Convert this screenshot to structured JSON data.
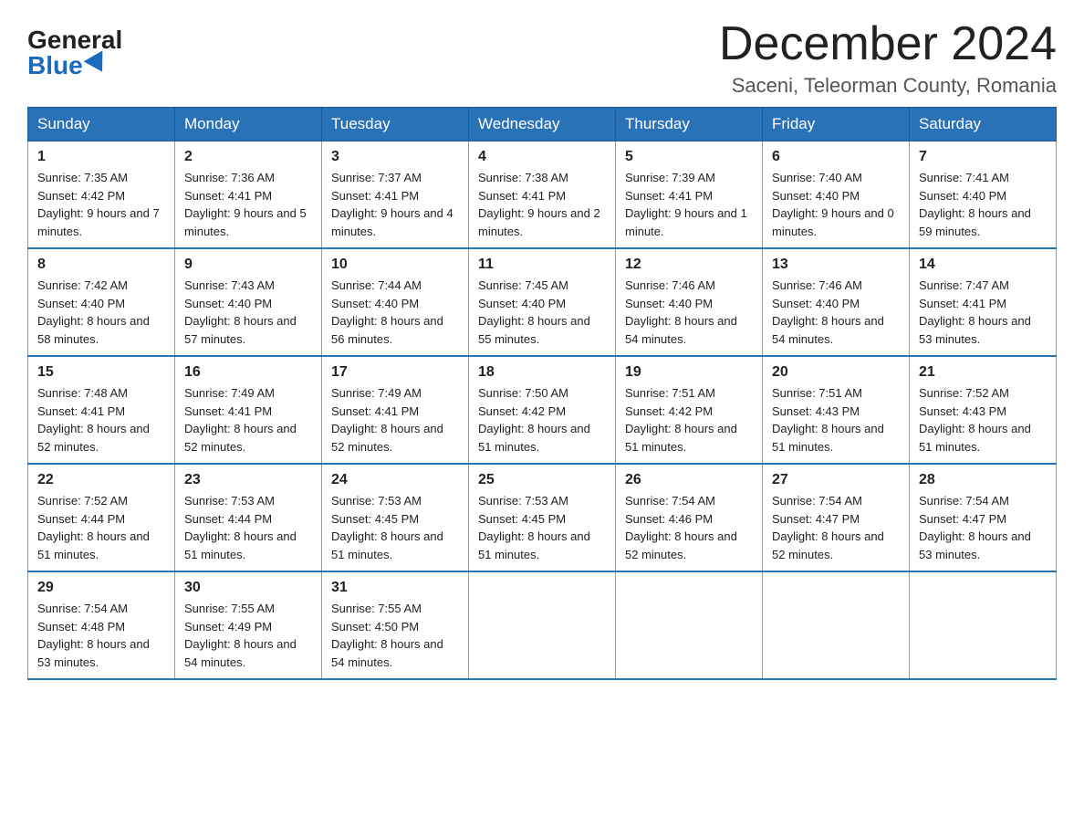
{
  "logo": {
    "general": "General",
    "blue": "Blue"
  },
  "header": {
    "month_year": "December 2024",
    "location": "Saceni, Teleorman County, Romania"
  },
  "weekdays": [
    "Sunday",
    "Monday",
    "Tuesday",
    "Wednesday",
    "Thursday",
    "Friday",
    "Saturday"
  ],
  "weeks": [
    [
      {
        "day": "1",
        "sunrise": "7:35 AM",
        "sunset": "4:42 PM",
        "daylight": "9 hours and 7 minutes."
      },
      {
        "day": "2",
        "sunrise": "7:36 AM",
        "sunset": "4:41 PM",
        "daylight": "9 hours and 5 minutes."
      },
      {
        "day": "3",
        "sunrise": "7:37 AM",
        "sunset": "4:41 PM",
        "daylight": "9 hours and 4 minutes."
      },
      {
        "day": "4",
        "sunrise": "7:38 AM",
        "sunset": "4:41 PM",
        "daylight": "9 hours and 2 minutes."
      },
      {
        "day": "5",
        "sunrise": "7:39 AM",
        "sunset": "4:41 PM",
        "daylight": "9 hours and 1 minute."
      },
      {
        "day": "6",
        "sunrise": "7:40 AM",
        "sunset": "4:40 PM",
        "daylight": "9 hours and 0 minutes."
      },
      {
        "day": "7",
        "sunrise": "7:41 AM",
        "sunset": "4:40 PM",
        "daylight": "8 hours and 59 minutes."
      }
    ],
    [
      {
        "day": "8",
        "sunrise": "7:42 AM",
        "sunset": "4:40 PM",
        "daylight": "8 hours and 58 minutes."
      },
      {
        "day": "9",
        "sunrise": "7:43 AM",
        "sunset": "4:40 PM",
        "daylight": "8 hours and 57 minutes."
      },
      {
        "day": "10",
        "sunrise": "7:44 AM",
        "sunset": "4:40 PM",
        "daylight": "8 hours and 56 minutes."
      },
      {
        "day": "11",
        "sunrise": "7:45 AM",
        "sunset": "4:40 PM",
        "daylight": "8 hours and 55 minutes."
      },
      {
        "day": "12",
        "sunrise": "7:46 AM",
        "sunset": "4:40 PM",
        "daylight": "8 hours and 54 minutes."
      },
      {
        "day": "13",
        "sunrise": "7:46 AM",
        "sunset": "4:40 PM",
        "daylight": "8 hours and 54 minutes."
      },
      {
        "day": "14",
        "sunrise": "7:47 AM",
        "sunset": "4:41 PM",
        "daylight": "8 hours and 53 minutes."
      }
    ],
    [
      {
        "day": "15",
        "sunrise": "7:48 AM",
        "sunset": "4:41 PM",
        "daylight": "8 hours and 52 minutes."
      },
      {
        "day": "16",
        "sunrise": "7:49 AM",
        "sunset": "4:41 PM",
        "daylight": "8 hours and 52 minutes."
      },
      {
        "day": "17",
        "sunrise": "7:49 AM",
        "sunset": "4:41 PM",
        "daylight": "8 hours and 52 minutes."
      },
      {
        "day": "18",
        "sunrise": "7:50 AM",
        "sunset": "4:42 PM",
        "daylight": "8 hours and 51 minutes."
      },
      {
        "day": "19",
        "sunrise": "7:51 AM",
        "sunset": "4:42 PM",
        "daylight": "8 hours and 51 minutes."
      },
      {
        "day": "20",
        "sunrise": "7:51 AM",
        "sunset": "4:43 PM",
        "daylight": "8 hours and 51 minutes."
      },
      {
        "day": "21",
        "sunrise": "7:52 AM",
        "sunset": "4:43 PM",
        "daylight": "8 hours and 51 minutes."
      }
    ],
    [
      {
        "day": "22",
        "sunrise": "7:52 AM",
        "sunset": "4:44 PM",
        "daylight": "8 hours and 51 minutes."
      },
      {
        "day": "23",
        "sunrise": "7:53 AM",
        "sunset": "4:44 PM",
        "daylight": "8 hours and 51 minutes."
      },
      {
        "day": "24",
        "sunrise": "7:53 AM",
        "sunset": "4:45 PM",
        "daylight": "8 hours and 51 minutes."
      },
      {
        "day": "25",
        "sunrise": "7:53 AM",
        "sunset": "4:45 PM",
        "daylight": "8 hours and 51 minutes."
      },
      {
        "day": "26",
        "sunrise": "7:54 AM",
        "sunset": "4:46 PM",
        "daylight": "8 hours and 52 minutes."
      },
      {
        "day": "27",
        "sunrise": "7:54 AM",
        "sunset": "4:47 PM",
        "daylight": "8 hours and 52 minutes."
      },
      {
        "day": "28",
        "sunrise": "7:54 AM",
        "sunset": "4:47 PM",
        "daylight": "8 hours and 53 minutes."
      }
    ],
    [
      {
        "day": "29",
        "sunrise": "7:54 AM",
        "sunset": "4:48 PM",
        "daylight": "8 hours and 53 minutes."
      },
      {
        "day": "30",
        "sunrise": "7:55 AM",
        "sunset": "4:49 PM",
        "daylight": "8 hours and 54 minutes."
      },
      {
        "day": "31",
        "sunrise": "7:55 AM",
        "sunset": "4:50 PM",
        "daylight": "8 hours and 54 minutes."
      },
      null,
      null,
      null,
      null
    ]
  ]
}
